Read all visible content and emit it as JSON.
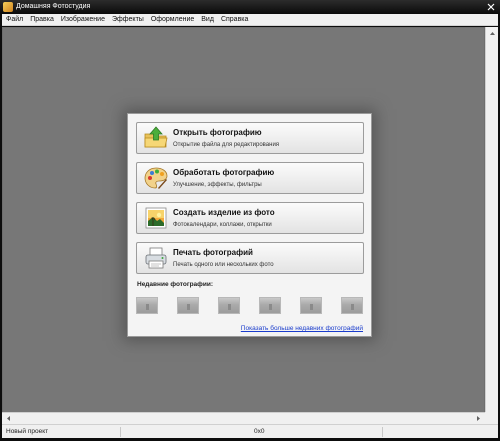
{
  "window": {
    "title": "Домашняя Фотостудия"
  },
  "menu": {
    "items": [
      "Файл",
      "Правка",
      "Изображение",
      "Эффекты",
      "Оформление",
      "Вид",
      "Справка"
    ]
  },
  "start_panel": {
    "actions": [
      {
        "icon": "open-folder-icon",
        "title": "Открыть фотографию",
        "subtitle": "Открытие файла для редактирования"
      },
      {
        "icon": "palette-icon",
        "title": "Обработать фотографию",
        "subtitle": "Улучшение, эффекты, фильтры"
      },
      {
        "icon": "photo-product-icon",
        "title": "Создать изделие из фото",
        "subtitle": "Фотокалендари, коллажи, открытки"
      },
      {
        "icon": "printer-icon",
        "title": "Печать фотографий",
        "subtitle": "Печать одного или нескольких фото"
      }
    ],
    "recent_label": "Недавние фотографии:",
    "recent_count": 6,
    "more_link": "Показать больше недавних фотографий"
  },
  "statusbar": {
    "project": "Новый проект",
    "dimensions": "0x0"
  },
  "colors": {
    "workspace": "#777777",
    "link": "#1a3ccc",
    "titlebar": "#0a0a0a"
  }
}
